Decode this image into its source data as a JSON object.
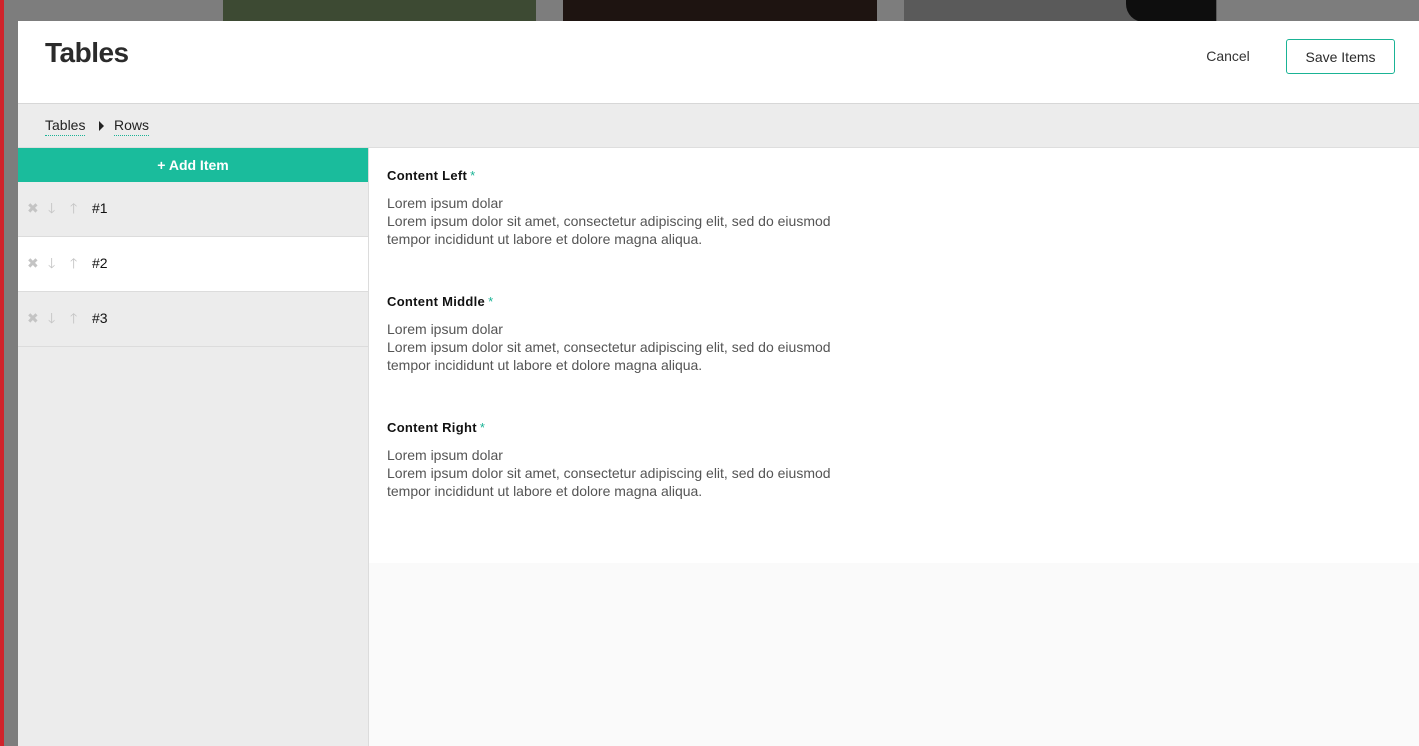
{
  "header": {
    "title": "Tables",
    "cancel_label": "Cancel",
    "save_label": "Save Items"
  },
  "breadcrumb": {
    "items": [
      "Tables",
      "Rows"
    ]
  },
  "sidebar": {
    "add_label": "+ Add Item",
    "rows": [
      {
        "label": "#1",
        "active": false
      },
      {
        "label": "#2",
        "active": true
      },
      {
        "label": "#3",
        "active": false
      }
    ],
    "row_icons": [
      "close-icon",
      "arrow-down-icon",
      "arrow-up-icon"
    ]
  },
  "fields": [
    {
      "label": "Content Left",
      "required_mark": "*",
      "value": "Lorem ipsum dolar\nLorem ipsum dolor sit amet, consectetur adipiscing elit, sed do eiusmod\ntempor incididunt ut labore et dolore magna aliqua."
    },
    {
      "label": "Content Middle",
      "required_mark": "*",
      "value": "Lorem ipsum dolar\nLorem ipsum dolor sit amet, consectetur adipiscing elit, sed do eiusmod\ntempor incididunt ut labore et dolore magna aliqua."
    },
    {
      "label": "Content Right",
      "required_mark": "*",
      "value": "Lorem ipsum dolar\nLorem ipsum dolor sit amet, consectetur adipiscing elit, sed do eiusmod\ntempor incididunt ut labore et dolore magna aliqua."
    }
  ],
  "colors": {
    "accent": "#1abc9c",
    "accent_border": "#1ab395",
    "overlay_edge": "#d0232b"
  }
}
